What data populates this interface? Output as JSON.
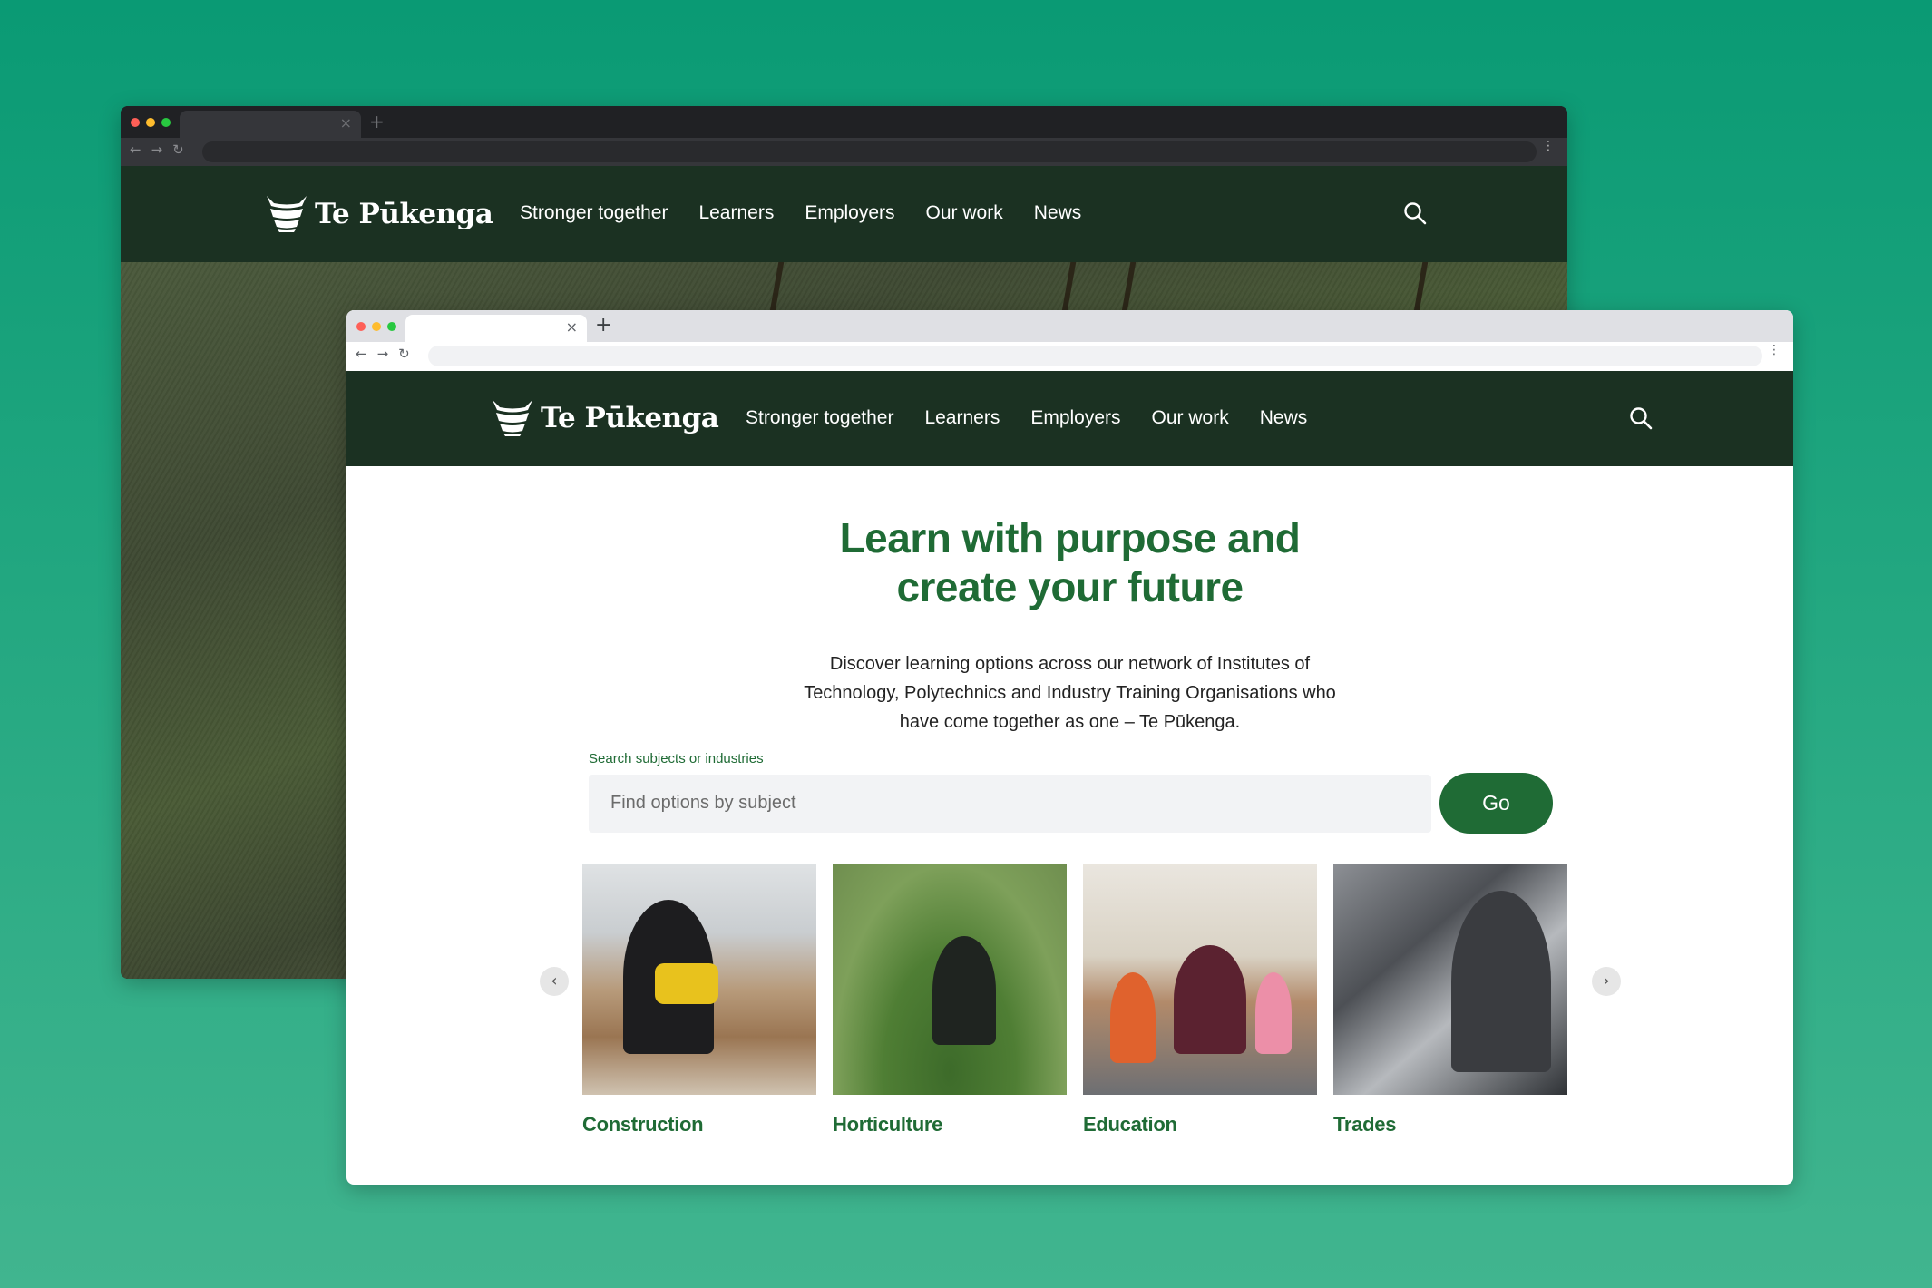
{
  "brand": {
    "name": "Te Pūkenga",
    "colors": {
      "nav_bg": "#1b3122",
      "accent_green": "#1f6b35",
      "background_top": "#0a9a74",
      "background_bottom": "#41b58f"
    }
  },
  "browser_chrome": {
    "tab_close": "×",
    "new_tab": "+",
    "back": "←",
    "forward": "→",
    "reload": "↻",
    "menu": "⋮"
  },
  "nav": {
    "items": [
      {
        "label": "Stronger together"
      },
      {
        "label": "Learners"
      },
      {
        "label": "Employers"
      },
      {
        "label": "Our work"
      },
      {
        "label": "News"
      }
    ],
    "search_icon": "search-icon"
  },
  "hero": {
    "title_line1": "Learn with purpose and",
    "title_line2": "create your future",
    "description": "Discover learning options across our network of Institutes of Technology, Polytechnics and Industry Training Organisations who have come together as one – Te Pūkenga."
  },
  "search": {
    "label": "Search subjects or industries",
    "placeholder": "Find options by subject",
    "value": "",
    "button_label": "Go"
  },
  "carousel": {
    "prev": "‹",
    "next": "›",
    "cards": [
      {
        "label": "Construction"
      },
      {
        "label": "Horticulture"
      },
      {
        "label": "Education"
      },
      {
        "label": "Trades"
      }
    ]
  }
}
